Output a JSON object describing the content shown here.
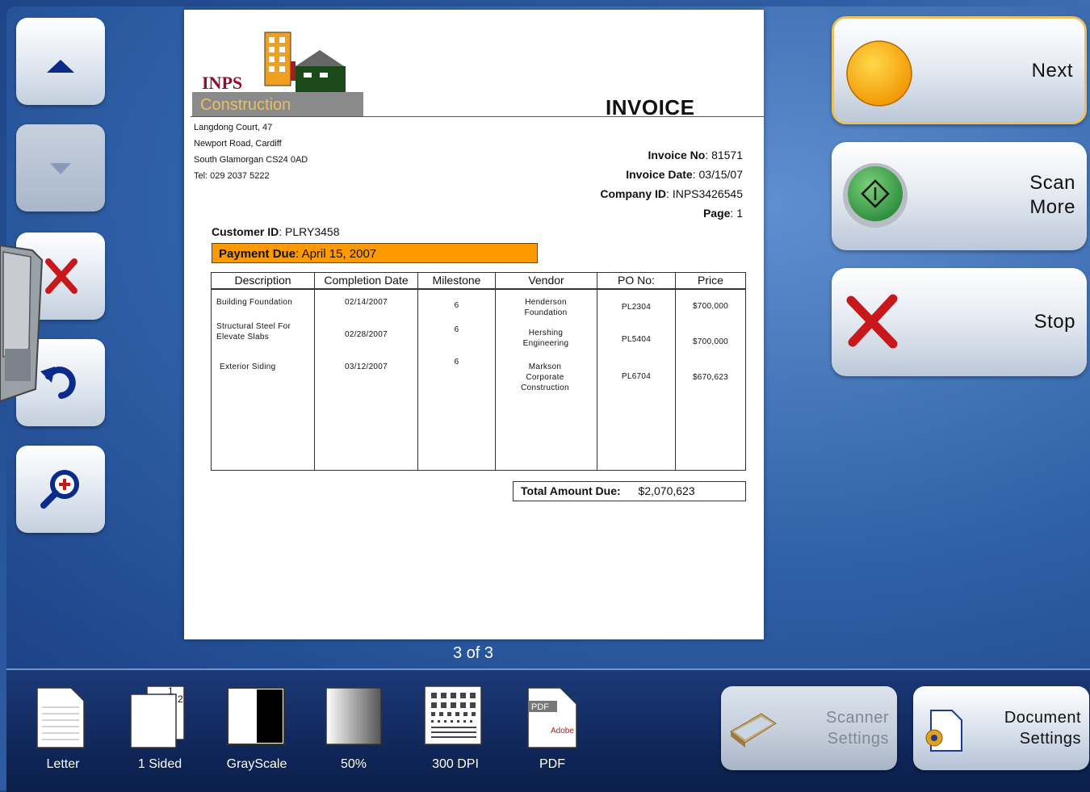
{
  "document": {
    "company_logo_top": "INPS",
    "company_logo_bottom": "Construction",
    "title": "INVOICE",
    "address_lines": [
      "Langdong Court, 47",
      "Newport Road, Cardiff",
      "South Glamorgan CS24 0AD",
      "Tel: 029 2037 5222"
    ],
    "invoice_no_label": "Invoice No",
    "invoice_no": "81571",
    "invoice_date_label": "Invoice Date",
    "invoice_date": "03/15/07",
    "company_id_label": "Company ID",
    "company_id": "INPS3426545",
    "page_label": "Page",
    "page": "1",
    "customer_id_label": "Customer ID",
    "customer_id": "PLRY3458",
    "payment_due_label": "Payment Due",
    "payment_due": "April 15, 2007",
    "table": {
      "headers": [
        "Description",
        "Completion Date",
        "Milestone",
        "Vendor",
        "PO No:",
        "Price"
      ],
      "rows": [
        {
          "description": "Building Foundation",
          "date": "02/14/2007",
          "milestone": "6",
          "vendor": "Henderson Foundation",
          "po": "PL2304",
          "price": "$700,000"
        },
        {
          "description": "Structural Steel For Elevate Slabs",
          "date": "02/28/2007",
          "milestone": "6",
          "vendor": "Hershing Engineering",
          "po": "PL5404",
          "price": "$700,000"
        },
        {
          "description": "Exterior Siding",
          "date": "03/12/2007",
          "milestone": "6",
          "vendor": "Markson Corporate Construction",
          "po": "PL6704",
          "price": "$670,623"
        }
      ]
    },
    "total_label": "Total Amount Due:",
    "total": "$2,070,623"
  },
  "page_indicator": "3 of 3",
  "actions": {
    "next": "Next",
    "scan_more_1": "Scan",
    "scan_more_2": "More",
    "stop": "Stop"
  },
  "settings": [
    {
      "label": "Letter",
      "icon": "letter-page-icon"
    },
    {
      "label": "1 Sided",
      "icon": "one-sided-icon"
    },
    {
      "label": "GrayScale",
      "icon": "grayscale-icon"
    },
    {
      "label": "50%",
      "icon": "brightness-icon"
    },
    {
      "label": "300 DPI",
      "icon": "resolution-icon"
    },
    {
      "label": "PDF",
      "icon": "pdf-icon"
    }
  ],
  "scanner_settings_1": "Scanner",
  "scanner_settings_2": "Settings",
  "document_settings_1": "Document",
  "document_settings_2": "Settings",
  "colors": {
    "accent_orange": "#ff9900",
    "go_green": "#3aa048",
    "stop_red": "#c8181c",
    "next_yellow": "#ffb000"
  }
}
